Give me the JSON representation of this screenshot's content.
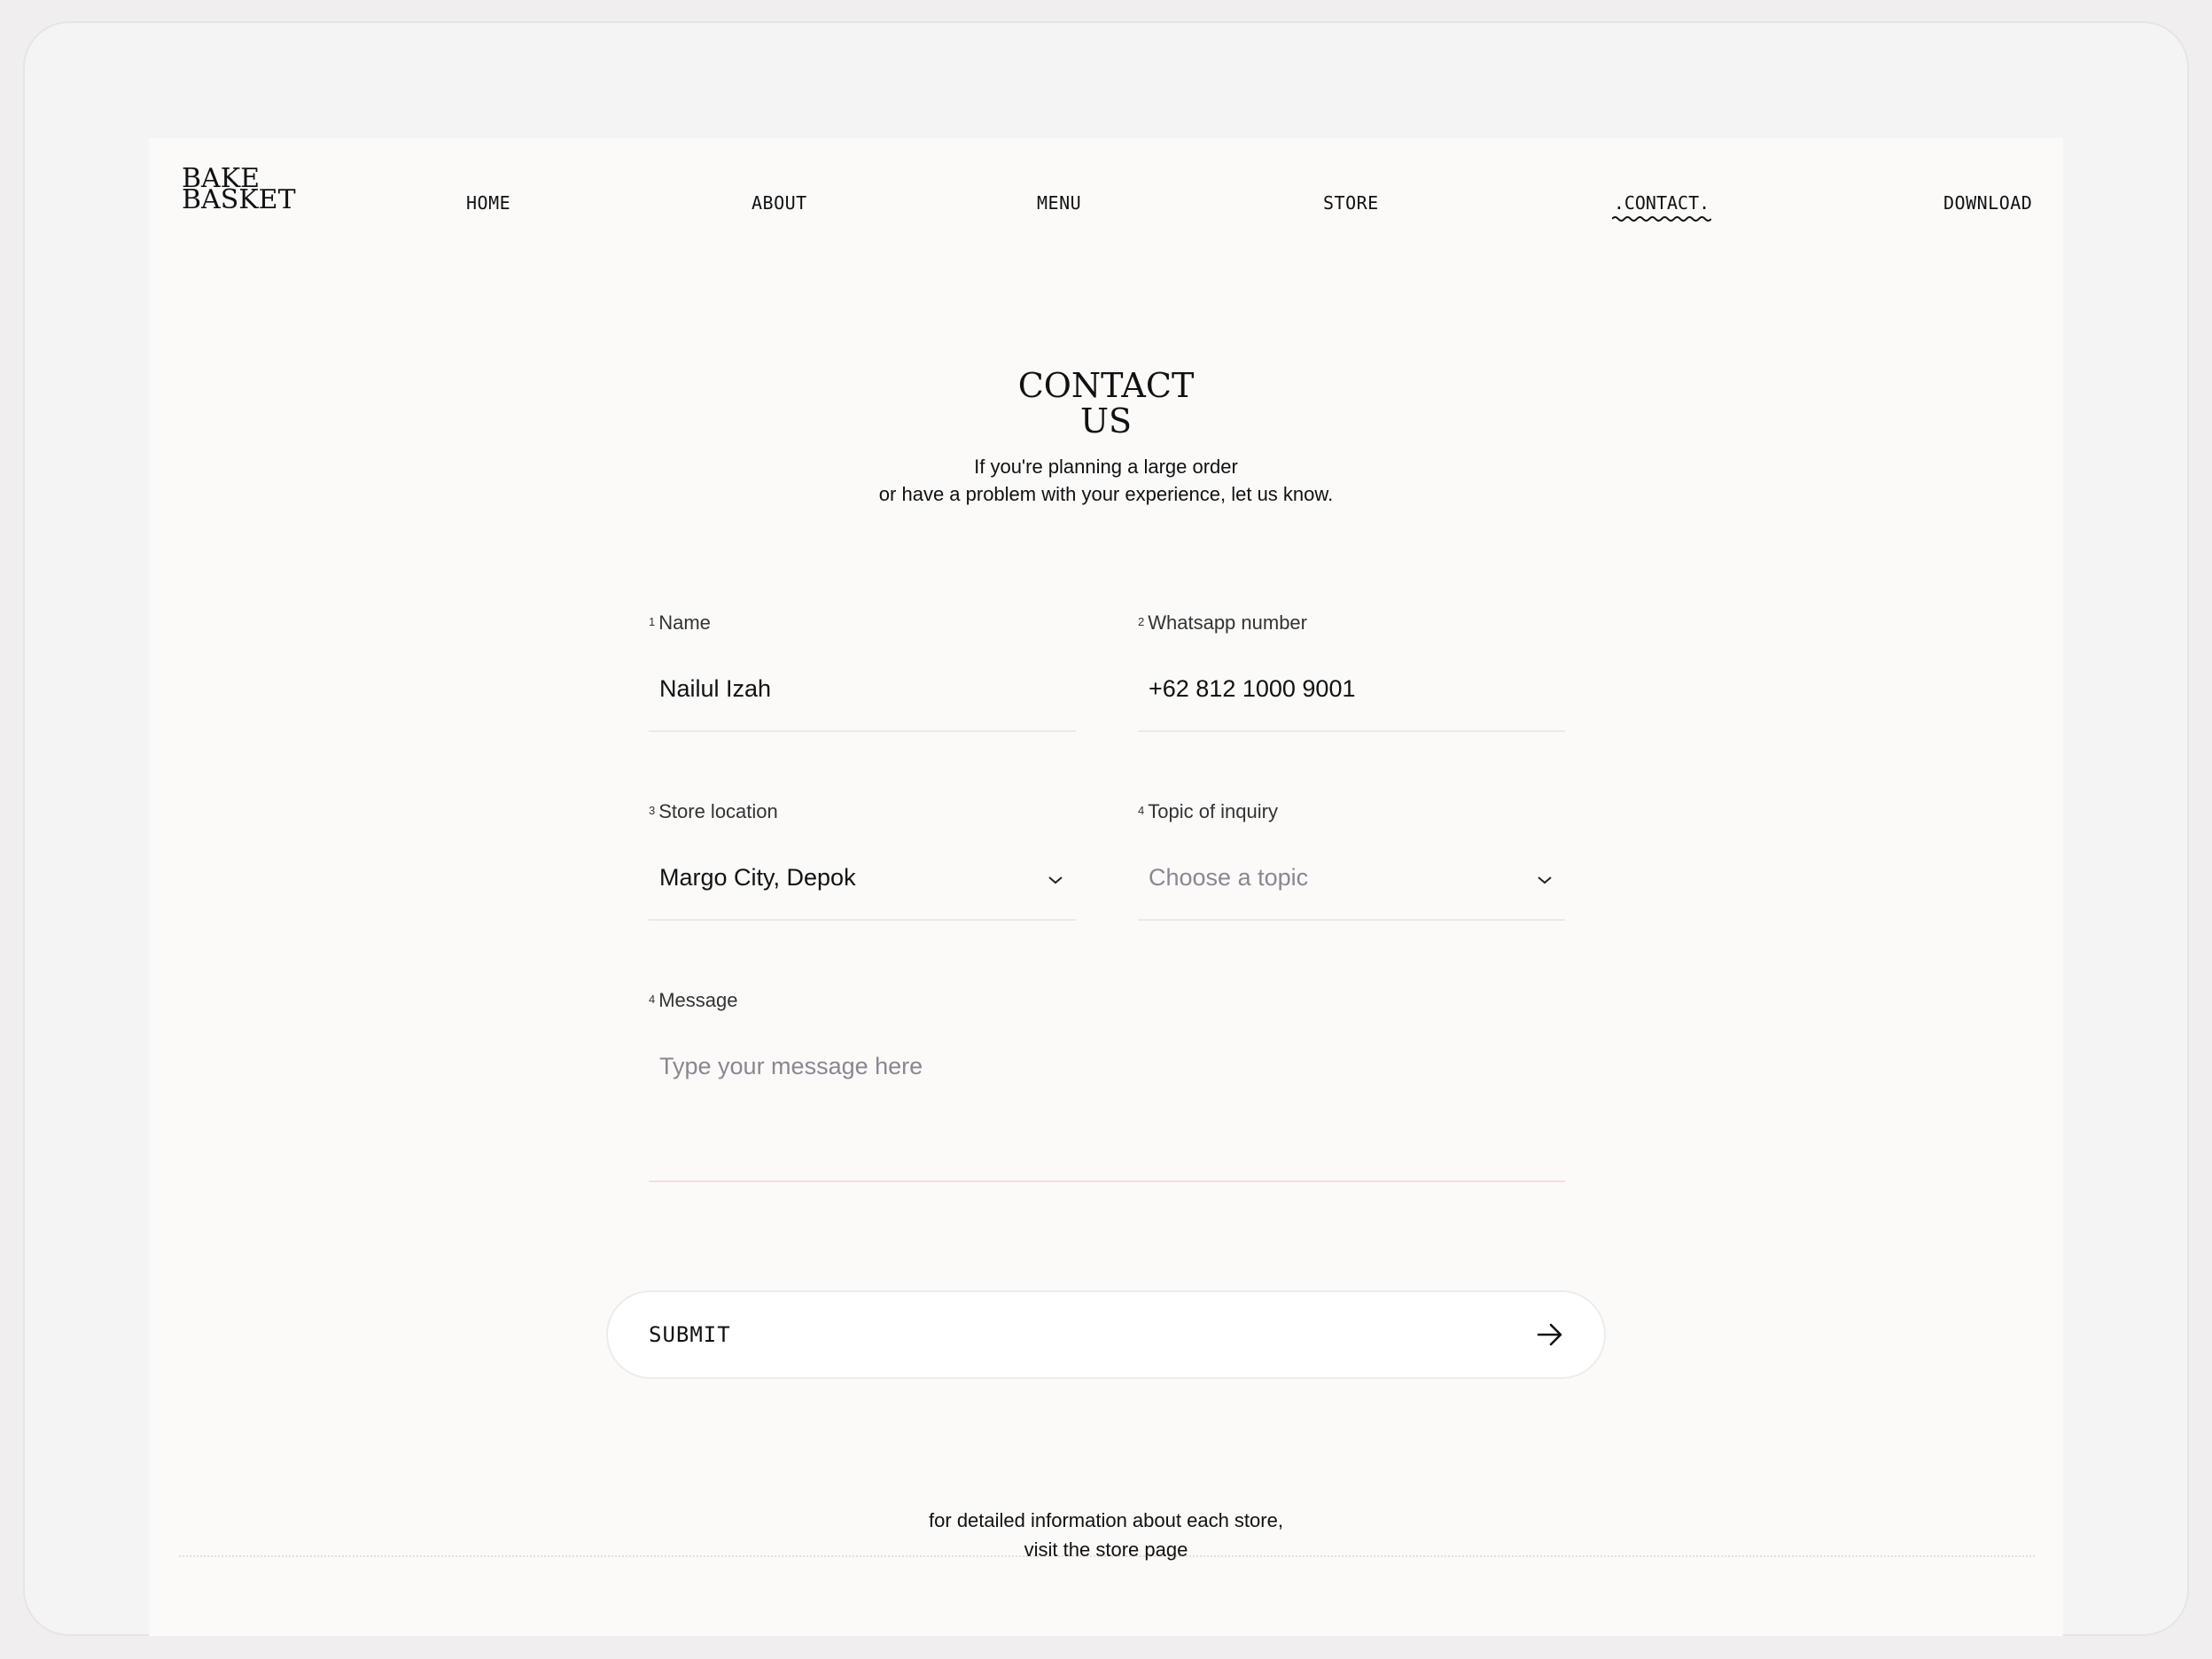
{
  "brand": {
    "line1": "BAKE",
    "line2": "BASKET"
  },
  "nav": {
    "home": "HOME",
    "about": "ABOUT",
    "menu": "MENU",
    "store": "STORE",
    "contact": ".CONTACT.",
    "download": "DOWNLOAD"
  },
  "hero": {
    "title_line1": "CONTACT",
    "title_line2": "US",
    "subtitle_line1": "If you're planning a large order",
    "subtitle_line2": "or have a problem with your experience, let us know."
  },
  "form": {
    "name": {
      "num": "1",
      "label": "Name",
      "value": "Nailul Izah"
    },
    "whatsapp": {
      "num": "2",
      "label": "Whatsapp number",
      "value": "+62 812 1000 9001"
    },
    "store_location": {
      "num": "3",
      "label": "Store location",
      "value": "Margo City, Depok",
      "icon": "chevron-down-icon"
    },
    "topic": {
      "num": "4",
      "label": "Topic of inquiry",
      "placeholder": "Choose a topic",
      "icon": "chevron-down-icon"
    },
    "message": {
      "num": "4",
      "label": "Message",
      "placeholder": "Type your message here"
    },
    "submit": {
      "label": "SUBMIT",
      "icon": "arrow-right-icon"
    }
  },
  "footer": {
    "line1": "for detailed information about each store,",
    "line2": "visit the store page"
  },
  "colors": {
    "background": "#f0eeef",
    "page": "#fbfaf9",
    "text": "#111111",
    "placeholder": "#8a8790",
    "button": "#ffffff"
  }
}
